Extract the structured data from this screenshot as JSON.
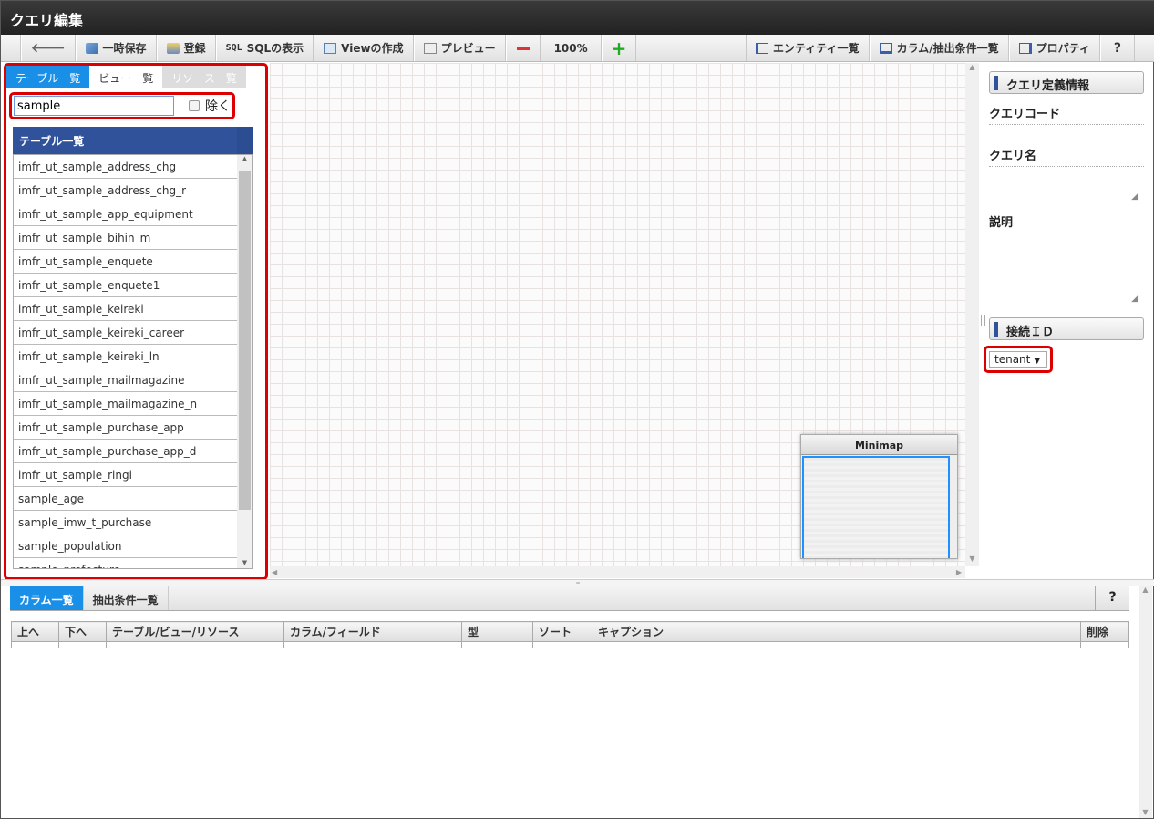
{
  "title": "クエリ編集",
  "toolbar": {
    "back": "",
    "temp_save": "一時保存",
    "register": "登録",
    "sql_prefix": "SQL",
    "sql": "SQLの表示",
    "view": "Viewの作成",
    "preview": "プレビュー",
    "zoom": "100%",
    "entity_list": "エンティティ一覧",
    "column_list": "カラム/抽出条件一覧",
    "property": "プロパティ",
    "help": "?"
  },
  "left": {
    "tabs": [
      "テーブル一覧",
      "ビュー一覧",
      "リソース一覧"
    ],
    "search_value": "sample",
    "exclude_label": "除く",
    "list_header": "テーブル一覧",
    "tables": [
      "imfr_ut_sample_address_chg",
      "imfr_ut_sample_address_chg_r",
      "imfr_ut_sample_app_equipment",
      "imfr_ut_sample_bihin_m",
      "imfr_ut_sample_enquete",
      "imfr_ut_sample_enquete1",
      "imfr_ut_sample_keireki",
      "imfr_ut_sample_keireki_career",
      "imfr_ut_sample_keireki_ln",
      "imfr_ut_sample_mailmagazine",
      "imfr_ut_sample_mailmagazine_n",
      "imfr_ut_sample_purchase_app",
      "imfr_ut_sample_purchase_app_d",
      "imfr_ut_sample_ringi",
      "sample_age",
      "sample_imw_t_purchase",
      "sample_population",
      "sample_prefecture"
    ]
  },
  "minimap": {
    "title": "Minimap"
  },
  "right": {
    "section_title": "クエリ定義情報",
    "query_code": "クエリコード",
    "query_name": "クエリ名",
    "description": "説明",
    "connection_title": "接続ＩＤ",
    "connection_value": "tenant"
  },
  "bottom": {
    "tabs": [
      "カラム一覧",
      "抽出条件一覧"
    ],
    "help": "?",
    "columns": [
      "上へ",
      "下へ",
      "テーブル/ビュー/リソース",
      "カラム/フィールド",
      "型",
      "ソート",
      "キャプション",
      "削除"
    ]
  }
}
